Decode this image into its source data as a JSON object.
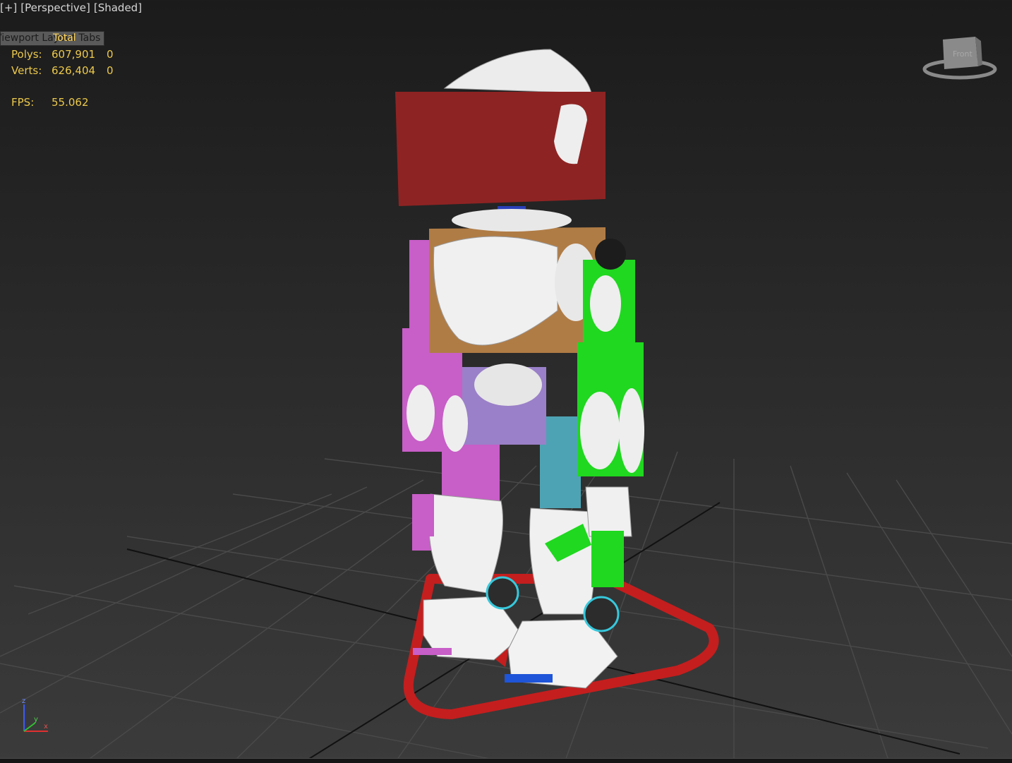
{
  "viewport": {
    "labels": [
      "[+]",
      "[Perspective]",
      "[Shaded]"
    ]
  },
  "overlay": {
    "tab_text": "Viewport Layout Tabs",
    "tab_overlap": "Total"
  },
  "stats": {
    "polys_label": "Polys:",
    "polys_total": "607,901",
    "polys_selected": "0",
    "verts_label": "Verts:",
    "verts_total": "626,404",
    "verts_selected": "0",
    "fps_label": "FPS:",
    "fps_value": "55.062"
  },
  "viewcube": {
    "face_label": "Front"
  },
  "axis_tripod": {
    "z": "z",
    "x": "x",
    "y": "y"
  },
  "colors": {
    "head_box": "#8e2323",
    "torso_box": "#b07c45",
    "left_limbs": "#c85ec8",
    "right_limbs": "#1fd81f",
    "hip_box": "#9a80c8",
    "shin_right": "#4da3b3",
    "ground_control": "#c41e1e",
    "robot_shell": "#f2f2f2",
    "stats_text": "#ecc94c"
  }
}
